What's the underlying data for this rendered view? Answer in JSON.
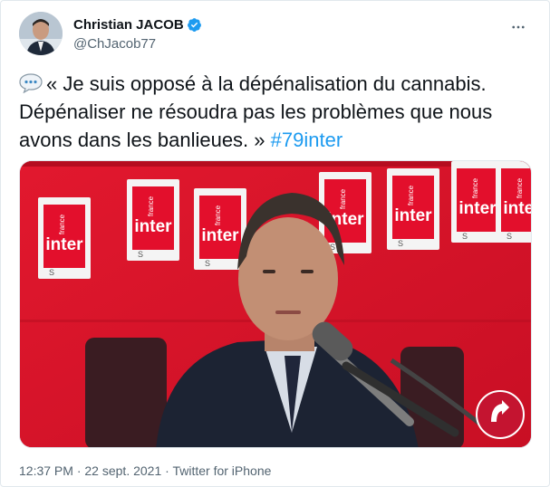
{
  "author": {
    "display_name": "Christian JACOB",
    "handle": "@ChJacob77",
    "verified": true,
    "verified_icon": "verified-badge-icon"
  },
  "tweet": {
    "emoji": "speech-balloon-emoji",
    "text": "« Je suis opposé à la dépénalisation du cannabis. Dépénaliser ne résoudra pas les problèmes que nous avons dans les banlieues. »",
    "hashtag": "#79inter"
  },
  "media": {
    "logo_top_label": "france",
    "logo_label": "inter",
    "type": "video"
  },
  "meta": {
    "time": "12:37 PM",
    "separator": "·",
    "date": "22 sept. 2021",
    "source": "Twitter for iPhone"
  },
  "colors": {
    "accent": "#1d9bf0",
    "brand_red": "#d8122a"
  }
}
